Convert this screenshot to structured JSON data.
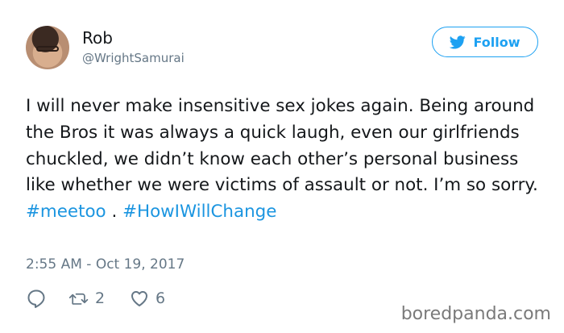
{
  "user": {
    "name": "Rob",
    "handle": "@WrightSamurai"
  },
  "follow_button": {
    "label": "Follow",
    "icon": "twitter-bird-icon",
    "color": "#1da1f2"
  },
  "tweet": {
    "text_parts": [
      "I will never make insensitive sex jokes again. Being around the Bros it was always a quick laugh, even our girlfriends chuckled, we didn’t know each other’s personal business like whether we were victims of assault or not. I’m so sorry. ",
      "#meetoo",
      " . ",
      "#HowIWillChange"
    ],
    "hashtag_color": "#1b95e0",
    "timestamp": "2:55 AM - Oct 19, 2017"
  },
  "actions": {
    "reply_icon": "reply-icon",
    "retweet_icon": "retweet-icon",
    "retweet_count": "2",
    "like_icon": "heart-icon",
    "like_count": "6"
  },
  "watermark": "boredpanda.com"
}
